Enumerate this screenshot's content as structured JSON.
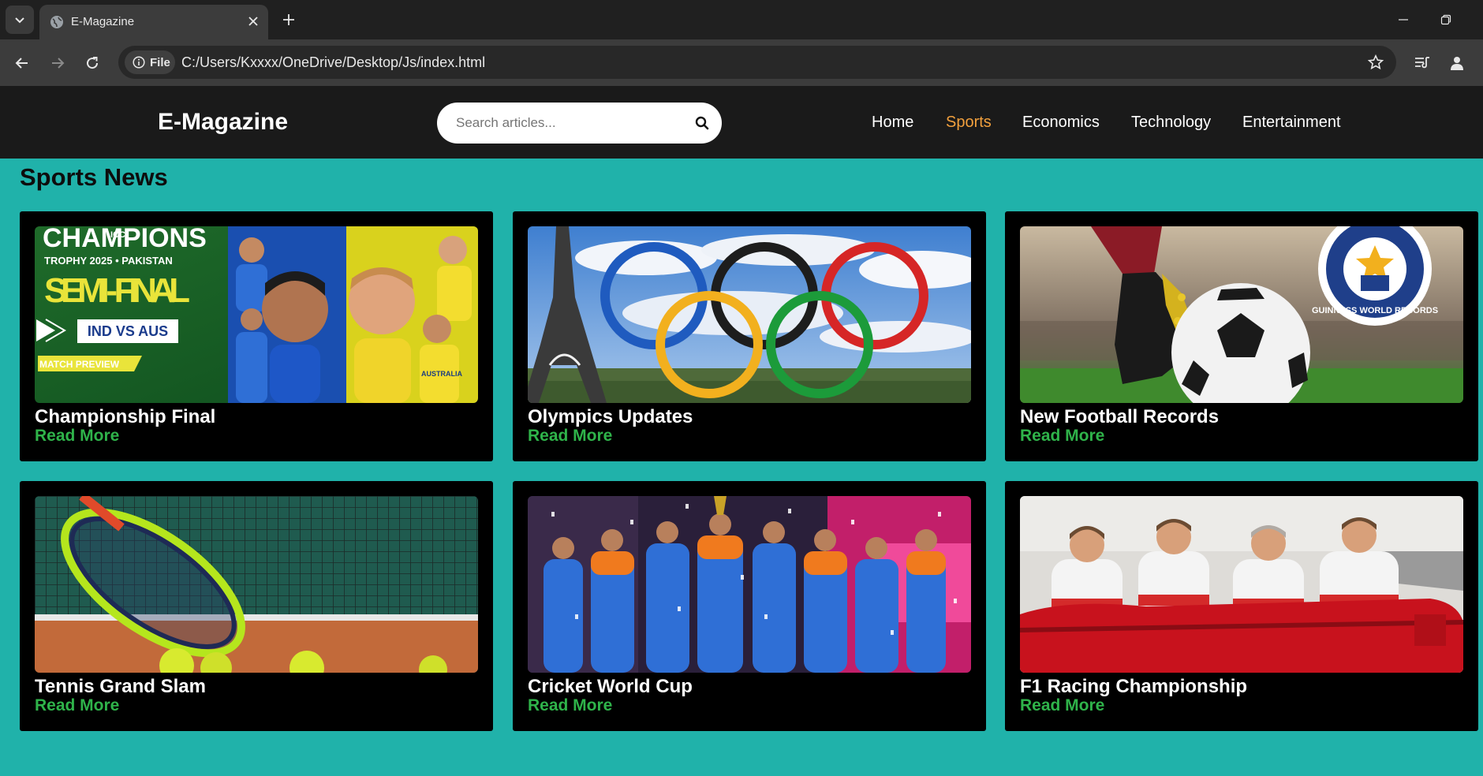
{
  "browser": {
    "tab_title": "E-Magazine",
    "file_chip_label": "File",
    "url": "C:/Users/Kxxxx/OneDrive/Desktop/Js/index.html"
  },
  "site": {
    "logo": "E-Magazine",
    "search_placeholder": "Search articles...",
    "nav": [
      {
        "label": "Home",
        "active": false
      },
      {
        "label": "Sports",
        "active": true
      },
      {
        "label": "Economics",
        "active": false
      },
      {
        "label": "Technology",
        "active": false
      },
      {
        "label": "Entertainment",
        "active": false
      }
    ],
    "accent_color": "#f2a03d",
    "link_color": "#2fb34a",
    "page_bg": "#20b2aa"
  },
  "section": {
    "title": "Sports News"
  },
  "cards": [
    {
      "title": "Championship Final",
      "link": "Read More",
      "image": {
        "line1": "CHAMPIONS",
        "badge": "ICC",
        "line2": "TROPHY 2025 • PAKISTAN",
        "line3": "SEMI - FINAL",
        "matchup": "IND VS AUS",
        "tag": "MATCH PREVIEW",
        "jersey": "AUSTRALIA"
      }
    },
    {
      "title": "Olympics Updates",
      "link": "Read More"
    },
    {
      "title": "New Football Records",
      "link": "Read More",
      "image": {
        "seal_text": "GUINNESS WORLD RECORDS"
      }
    },
    {
      "title": "Tennis Grand Slam",
      "link": "Read More"
    },
    {
      "title": "Cricket World Cup",
      "link": "Read More"
    },
    {
      "title": "F1 Racing Championship",
      "link": "Read More"
    }
  ]
}
